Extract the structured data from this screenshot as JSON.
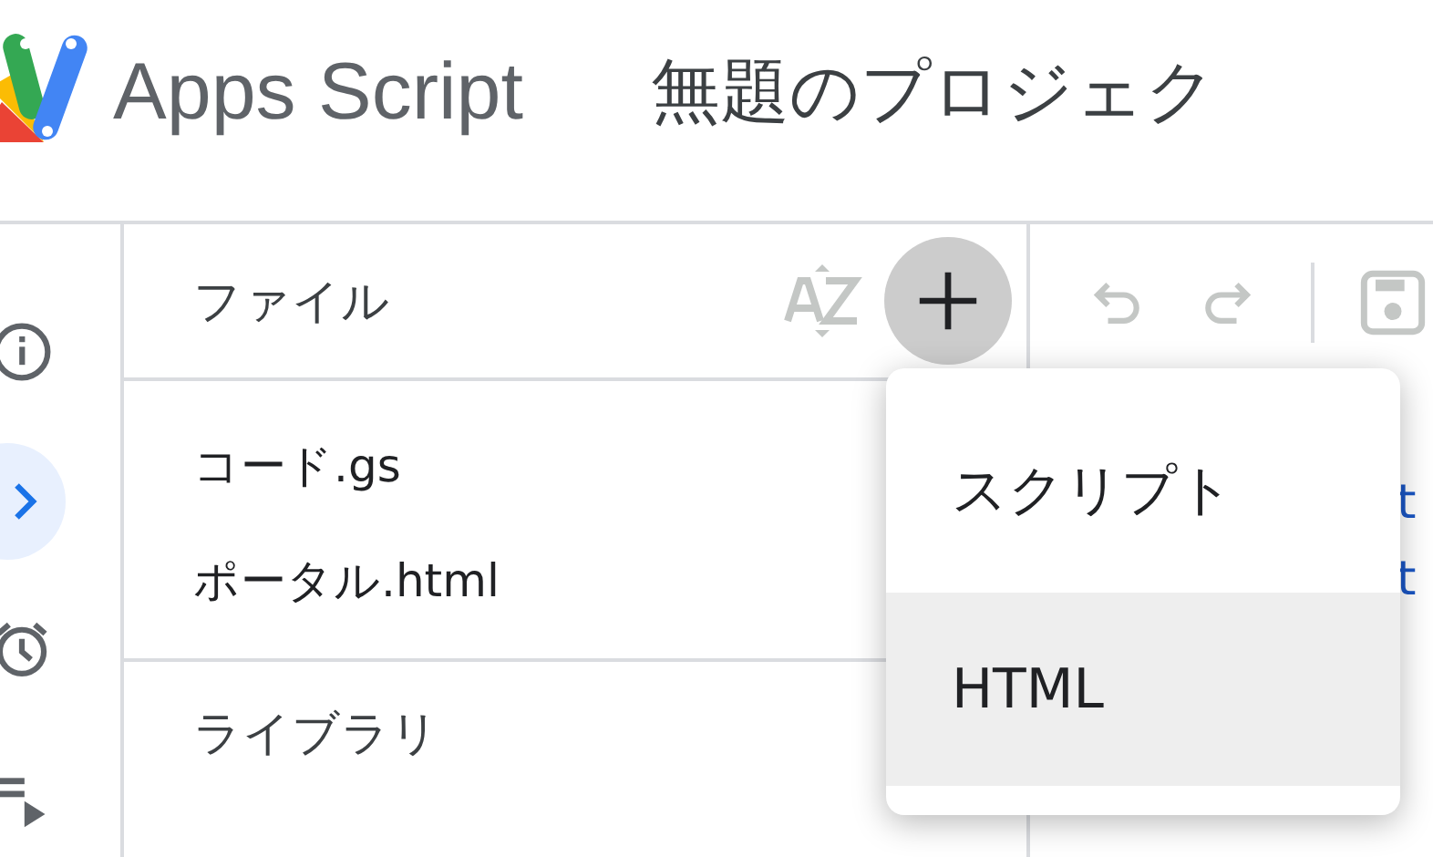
{
  "header": {
    "app_name": "Apps Script",
    "project_title": "無題のプロジェク"
  },
  "rail": [
    {
      "kind": "info",
      "selected": false
    },
    {
      "kind": "editor",
      "selected": true
    },
    {
      "kind": "triggers",
      "selected": false
    },
    {
      "kind": "executions",
      "selected": false
    }
  ],
  "files_panel": {
    "heading": "ファイル",
    "files": [
      {
        "name": "コード.gs"
      },
      {
        "name": "ポータル.html"
      }
    ],
    "libraries_heading": "ライブラリ"
  },
  "editor": {
    "code_lines": [
      "t",
      "t"
    ]
  },
  "add_menu": {
    "items": [
      {
        "label": "スクリプト",
        "selected": false
      },
      {
        "label": "HTML",
        "selected": true
      }
    ]
  }
}
